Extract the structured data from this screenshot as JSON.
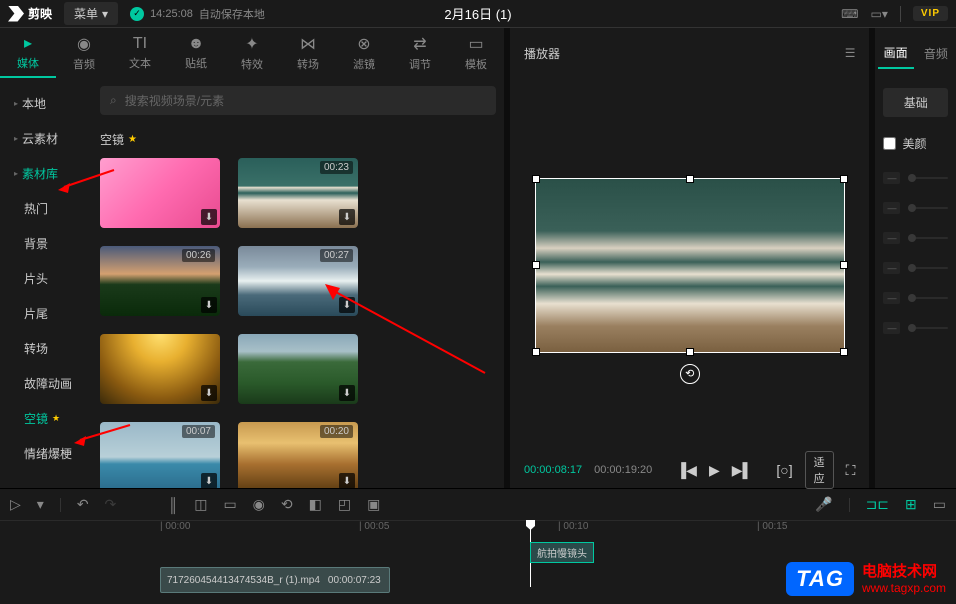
{
  "topbar": {
    "logo_text": "剪映",
    "menu": "菜单",
    "autosave_time": "14:25:08",
    "autosave_text": "自动保存本地",
    "project_name": "2月16日 (1)",
    "vip": "VIP"
  },
  "tool_tabs": [
    {
      "icon": "▸",
      "label": "媒体",
      "active": true
    },
    {
      "icon": "◉",
      "label": "音频"
    },
    {
      "icon": "TI",
      "label": "文本"
    },
    {
      "icon": "☻",
      "label": "贴纸"
    },
    {
      "icon": "✦",
      "label": "特效"
    },
    {
      "icon": "⋈",
      "label": "转场"
    },
    {
      "icon": "⊗",
      "label": "滤镜"
    },
    {
      "icon": "⇄",
      "label": "调节"
    },
    {
      "icon": "▭",
      "label": "模板"
    }
  ],
  "sidebar": {
    "items": [
      {
        "label": "本地",
        "arrow": true
      },
      {
        "label": "云素材",
        "arrow": true
      },
      {
        "label": "素材库",
        "arrow": true,
        "active": true
      },
      {
        "label": "热门"
      },
      {
        "label": "背景"
      },
      {
        "label": "片头"
      },
      {
        "label": "片尾"
      },
      {
        "label": "转场"
      },
      {
        "label": "故障动画"
      },
      {
        "label": "空镜",
        "star": true,
        "active": true
      },
      {
        "label": "情绪爆梗"
      }
    ]
  },
  "search": {
    "placeholder": "搜索视频场景/元素"
  },
  "section_title": "空镜",
  "assets": [
    {
      "duration": "",
      "thumb": "thumb-flowers"
    },
    {
      "duration": "00:23",
      "thumb": "thumb-beach"
    },
    {
      "duration": "00:26",
      "thumb": "thumb-sunset"
    },
    {
      "duration": "00:27",
      "thumb": "thumb-wave"
    },
    {
      "duration": "",
      "thumb": "thumb-autumn"
    },
    {
      "duration": "",
      "thumb": "thumb-mountains"
    },
    {
      "duration": "00:07",
      "thumb": "thumb-island"
    },
    {
      "duration": "00:20",
      "thumb": "thumb-trees"
    }
  ],
  "player": {
    "title": "播放器",
    "current_time": "00:00:08:17",
    "total_time": "00:00:19:20",
    "fit_label": "适应"
  },
  "properties": {
    "tab_picture": "画面",
    "tab_audio": "音频",
    "basic": "基础",
    "beauty": "美颜"
  },
  "timeline": {
    "ticks": [
      "00:00",
      "00:05",
      "00:10",
      "00:15"
    ],
    "clip_name": "717260454413474534B_r (1).mp4",
    "clip_duration": "00:00:07:23",
    "clip_tag": "航拍慢镜头"
  },
  "watermark": {
    "logo": "TAG",
    "title": "电脑技术网",
    "url": "www.tagxp.com"
  }
}
